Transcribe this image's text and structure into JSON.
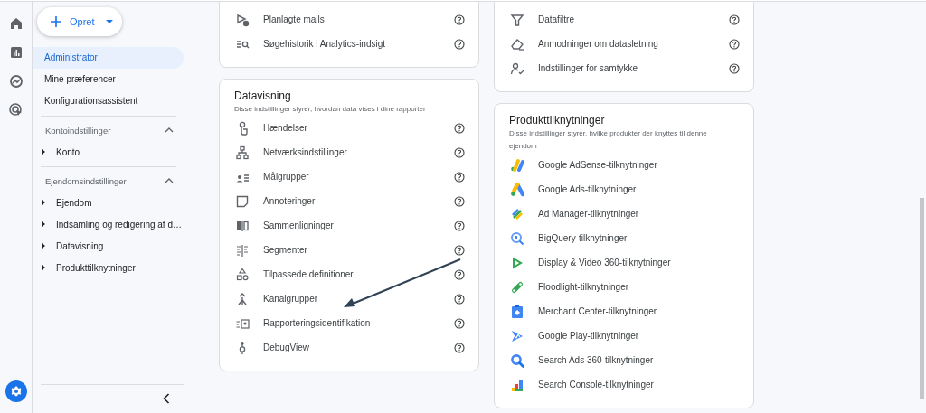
{
  "rail": {
    "items": [
      {
        "kind": "home",
        "selected": false
      },
      {
        "kind": "reports",
        "selected": false
      },
      {
        "kind": "explore",
        "selected": false
      },
      {
        "kind": "advertising",
        "selected": false
      }
    ],
    "settings": {
      "selected": true
    }
  },
  "sidebar": {
    "create_button": {
      "label": "Opret"
    },
    "nav": [
      {
        "label": "Administrator",
        "selected": true
      },
      {
        "label": "Mine præferencer",
        "selected": false
      },
      {
        "label": "Konfigurationsassistent",
        "selected": false
      }
    ],
    "sections": [
      {
        "title": "Kontoindstillinger",
        "expanded": true,
        "items": [
          {
            "label": "Konto",
            "expanded": false
          }
        ]
      },
      {
        "title": "Ejendomsindstillinger",
        "expanded": true,
        "items": [
          {
            "label": "Ejendom",
            "expanded": false
          },
          {
            "label": "Indsamling og redigering af d…",
            "expanded": false
          },
          {
            "label": "Datavisning",
            "expanded": false
          },
          {
            "label": "Produkttilknytninger",
            "expanded": false
          }
        ]
      }
    ]
  },
  "columns": [
    {
      "cards": [
        {
          "cut_top": true,
          "help": true,
          "rows": [
            {
              "label": "Planlagte mails"
            },
            {
              "label": "Søgehistorik i Analytics-indsigt"
            }
          ]
        },
        {
          "cut_top": false,
          "help": true,
          "title": "Datavisning",
          "subtitle": "Disse indstillinger styrer, hvordan data vises i dine rapporter",
          "rows": [
            {
              "label": "Hændelser"
            },
            {
              "label": "Netværksindstillinger"
            },
            {
              "label": "Målgrupper"
            },
            {
              "label": "Annoteringer"
            },
            {
              "label": "Sammenligninger"
            },
            {
              "label": "Segmenter"
            },
            {
              "label": "Tilpassede definitioner"
            },
            {
              "label": "Kanalgrupper"
            },
            {
              "label": "Rapporteringsidentifikation"
            },
            {
              "label": "DebugView"
            }
          ]
        }
      ]
    },
    {
      "cards": [
        {
          "cut_top": true,
          "help": true,
          "rows": [
            {
              "label": "Datafiltre"
            },
            {
              "label": "Anmodninger om datasletning"
            },
            {
              "label": "Indstillinger for samtykke"
            }
          ]
        },
        {
          "cut_top": false,
          "help": false,
          "title": "Produkttilknytninger",
          "subtitle": "Disse indstillinger styrer, hvilke produkter der knyttes til denne ejendom",
          "rows": [
            {
              "label": "Google AdSense-tilknytninger"
            },
            {
              "label": "Google Ads-tilknytninger"
            },
            {
              "label": "Ad Manager-tilknytninger"
            },
            {
              "label": "BigQuery-tilknytninger"
            },
            {
              "label": "Display & Video 360-tilknytninger"
            },
            {
              "label": "Floodlight-tilknytninger"
            },
            {
              "label": "Merchant Center-tilknytninger"
            },
            {
              "label": "Google Play-tilknytninger"
            },
            {
              "label": "Search Ads 360-tilknytninger"
            },
            {
              "label": "Search Console-tilknytninger"
            }
          ]
        }
      ]
    }
  ]
}
